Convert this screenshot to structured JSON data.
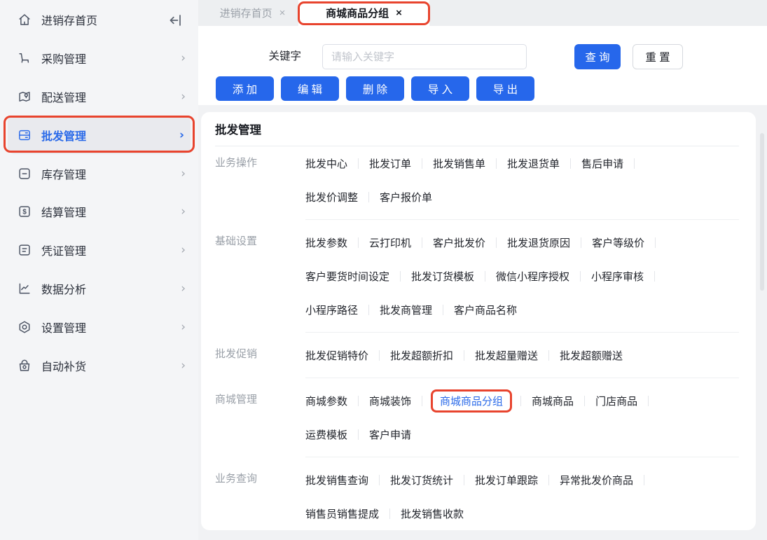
{
  "colors": {
    "accent_blue": "#2667eb",
    "link_blue": "#2a6ae9",
    "annotation_red": "#e8442e"
  },
  "sidebar": {
    "items": [
      {
        "label": "进销存首页"
      },
      {
        "label": "采购管理",
        "chevron": "›"
      },
      {
        "label": "配送管理",
        "chevron": "›"
      },
      {
        "label": "批发管理",
        "chevron": "›",
        "selected": true
      },
      {
        "label": "库存管理",
        "chevron": "›"
      },
      {
        "label": "结算管理",
        "chevron": "›"
      },
      {
        "label": "凭证管理",
        "chevron": "›"
      },
      {
        "label": "数据分析",
        "chevron": "›"
      },
      {
        "label": "设置管理",
        "chevron": "›"
      },
      {
        "label": "自动补货",
        "chevron": "›"
      }
    ],
    "settlement_glyph": "$"
  },
  "tabs": {
    "items": [
      {
        "label": "进销存首页",
        "close": "×",
        "active": false
      },
      {
        "label": "商城商品分组",
        "close": "×",
        "active": true
      }
    ]
  },
  "filter": {
    "keyword_label": "关键字",
    "keyword_placeholder": "请输入关键字",
    "keyword_value": "",
    "query": "查 询",
    "reset": "重 置"
  },
  "toolbar": {
    "add": "添 加",
    "edit": "编 辑",
    "delete": "删 除",
    "import": "导 入",
    "export": "导 出"
  },
  "panel": {
    "title": "批发管理",
    "active_link": "商城商品分组",
    "sections": [
      {
        "label": "业务操作",
        "rows": [
          [
            "批发中心",
            "批发订单",
            "批发销售单",
            "批发退货单",
            "售后申请"
          ],
          [
            "批发价调整",
            "客户报价单"
          ]
        ]
      },
      {
        "label": "基础设置",
        "rows": [
          [
            "批发参数",
            "云打印机",
            "客户批发价",
            "批发退货原因",
            "客户等级价"
          ],
          [
            "客户要货时间设定",
            "批发订货模板",
            "微信小程序授权",
            "小程序审核"
          ],
          [
            "小程序路径",
            "批发商管理",
            "客户商品名称"
          ]
        ]
      },
      {
        "label": "批发促销",
        "rows": [
          [
            "批发促销特价",
            "批发超额折扣",
            "批发超量赠送",
            "批发超额赠送"
          ]
        ]
      },
      {
        "label": "商城管理",
        "rows": [
          [
            "商城参数",
            "商城装饰",
            "商城商品分组",
            "商城商品",
            "门店商品"
          ],
          [
            "运费模板",
            "客户申请"
          ]
        ]
      },
      {
        "label": "业务查询",
        "rows": [
          [
            "批发销售查询",
            "批发订货统计",
            "批发订单跟踪",
            "异常批发价商品"
          ],
          [
            "销售员销售提成",
            "批发销售收款"
          ]
        ]
      }
    ]
  }
}
